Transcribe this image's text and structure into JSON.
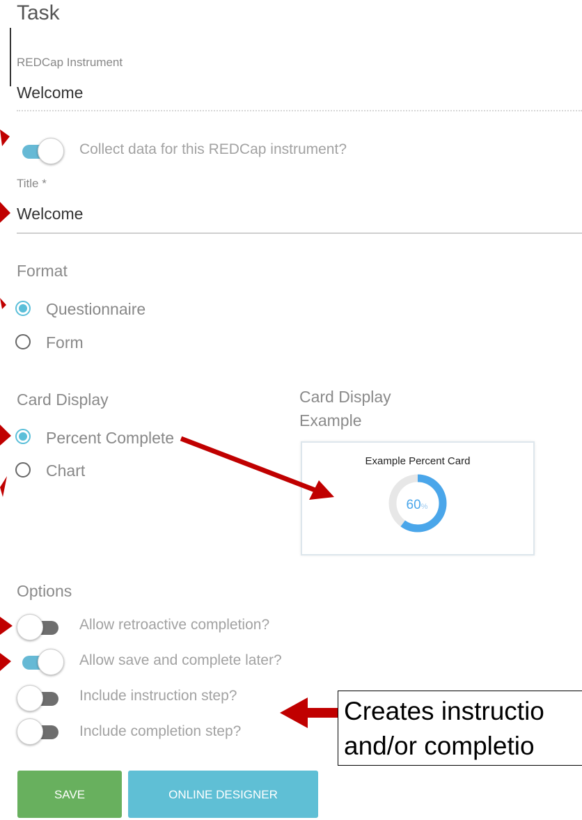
{
  "page": {
    "title": "Task"
  },
  "instrument": {
    "label": "REDCap Instrument",
    "value": "Welcome"
  },
  "collect": {
    "label": "Collect data for this REDCap instrument?",
    "on": true
  },
  "title_field": {
    "label": "Title *",
    "value": "Welcome"
  },
  "format": {
    "label": "Format",
    "options": [
      {
        "label": "Questionnaire",
        "selected": true
      },
      {
        "label": "Form",
        "selected": false
      }
    ]
  },
  "card_display": {
    "label": "Card Display",
    "options": [
      {
        "label": "Percent Complete",
        "selected": true
      },
      {
        "label": "Chart",
        "selected": false
      }
    ],
    "example_label_line1": "Card Display",
    "example_label_line2": "Example",
    "example_card": {
      "title": "Example Percent Card",
      "percent_text": "60",
      "percent_symbol": "%",
      "percent": 60
    }
  },
  "options": {
    "label": "Options",
    "toggles": [
      {
        "label": "Allow retroactive completion?",
        "on": false
      },
      {
        "label": "Allow save and complete later?",
        "on": true
      },
      {
        "label": "Include instruction step?",
        "on": false
      },
      {
        "label": "Include completion step?",
        "on": false
      }
    ]
  },
  "callout": {
    "line1": "Creates instructio",
    "line2": "and/or completio"
  },
  "buttons": {
    "save": "SAVE",
    "designer": "ONLINE DESIGNER"
  },
  "colors": {
    "accent": "#5bbfd9",
    "save": "#68b05e",
    "designer": "#5fbfd5",
    "arrow": "#c00000",
    "progress": "#4aa6ea"
  }
}
